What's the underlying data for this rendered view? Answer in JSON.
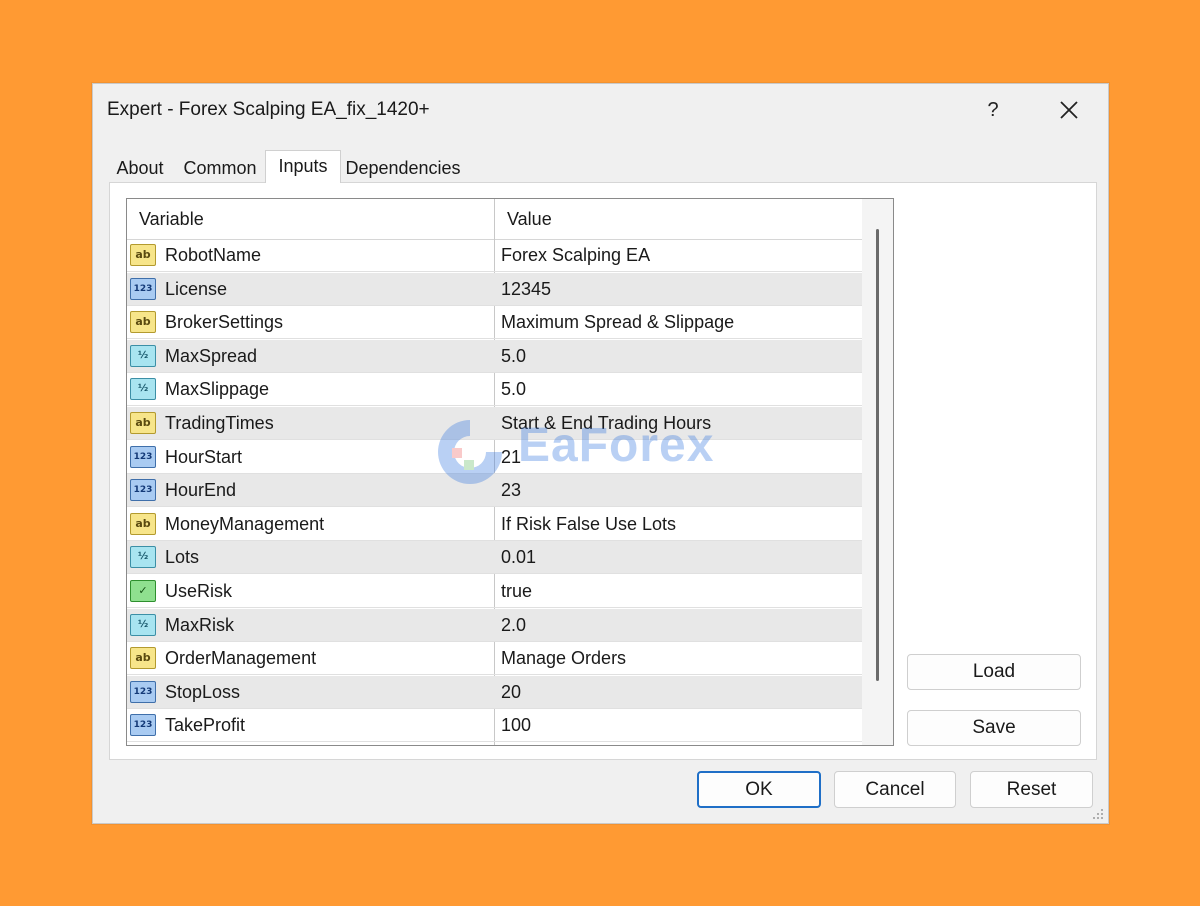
{
  "window": {
    "title": "Expert - Forex Scalping EA_fix_1420+",
    "help_label": "?"
  },
  "tabs": [
    {
      "label": "About"
    },
    {
      "label": "Common"
    },
    {
      "label": "Inputs",
      "active": true
    },
    {
      "label": "Dependencies"
    }
  ],
  "grid": {
    "headers": {
      "variable": "Variable",
      "value": "Value"
    },
    "rows": [
      {
        "icon": "string-type-icon",
        "badge": "ab",
        "name": "RobotName",
        "value": "Forex Scalping EA"
      },
      {
        "icon": "integer-type-icon",
        "badge": "123",
        "name": "License",
        "value": "12345"
      },
      {
        "icon": "string-type-icon",
        "badge": "ab",
        "name": "BrokerSettings",
        "value": "Maximum Spread & Slippage"
      },
      {
        "icon": "double-type-icon",
        "badge": "½",
        "name": "MaxSpread",
        "value": "5.0"
      },
      {
        "icon": "double-type-icon",
        "badge": "½",
        "name": "MaxSlippage",
        "value": "5.0"
      },
      {
        "icon": "string-type-icon",
        "badge": "ab",
        "name": "TradingTimes",
        "value": "Start & End Trading Hours"
      },
      {
        "icon": "integer-type-icon",
        "badge": "123",
        "name": "HourStart",
        "value": "21"
      },
      {
        "icon": "integer-type-icon",
        "badge": "123",
        "name": "HourEnd",
        "value": "23"
      },
      {
        "icon": "string-type-icon",
        "badge": "ab",
        "name": "MoneyManagement",
        "value": "If Risk False Use Lots"
      },
      {
        "icon": "double-type-icon",
        "badge": "½",
        "name": "Lots",
        "value": "0.01"
      },
      {
        "icon": "bool-type-icon",
        "badge": "✓",
        "name": "UseRisk",
        "value": "true"
      },
      {
        "icon": "double-type-icon",
        "badge": "½",
        "name": "MaxRisk",
        "value": "2.0"
      },
      {
        "icon": "string-type-icon",
        "badge": "ab",
        "name": "OrderManagement",
        "value": "Manage Orders"
      },
      {
        "icon": "integer-type-icon",
        "badge": "123",
        "name": "StopLoss",
        "value": "20"
      },
      {
        "icon": "integer-type-icon",
        "badge": "123",
        "name": "TakeProfit",
        "value": "100"
      }
    ]
  },
  "side_buttons": {
    "load": "Load",
    "save": "Save"
  },
  "footer_buttons": {
    "ok": "OK",
    "cancel": "Cancel",
    "reset": "Reset"
  },
  "watermark": {
    "text": "EaForex"
  }
}
